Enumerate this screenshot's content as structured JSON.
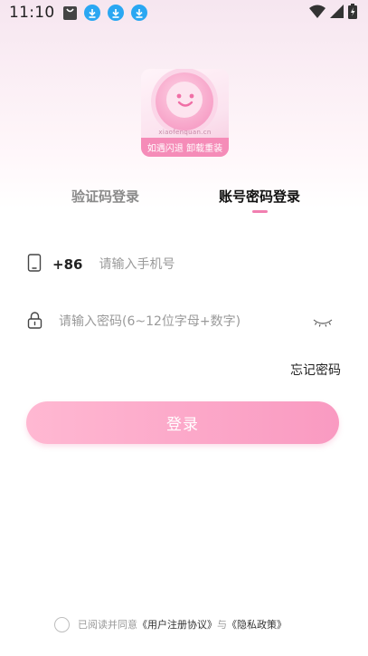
{
  "status_bar": {
    "time": "11:10",
    "icons": [
      "bag-icon",
      "download-icon",
      "download-icon",
      "download-icon",
      "wifi-icon",
      "signal-icon",
      "battery-charging-icon"
    ],
    "download_color": "#2aa7f2"
  },
  "logo": {
    "site_text": "xiaofenquan.cn",
    "banner_text": "如遇闪退  卸载重装"
  },
  "tabs": [
    {
      "label": "验证码登录",
      "active": false
    },
    {
      "label": "账号密码登录",
      "active": true
    }
  ],
  "phone": {
    "country_code": "+86",
    "placeholder": "请输入手机号",
    "value": ""
  },
  "password": {
    "placeholder": "请输入密码(6~12位字母+数字)",
    "value": ""
  },
  "forgot_label": "忘记密码",
  "login_label": "登录",
  "agreement": {
    "checked": false,
    "prefix": "已阅读并同意",
    "user_agreement": "《用户注册协议》",
    "connector": "与",
    "privacy_policy": "《隐私政策》"
  },
  "colors": {
    "accent": "#f17fb0",
    "button_start": "#ffb8d2",
    "button_end": "#f99ac1"
  }
}
